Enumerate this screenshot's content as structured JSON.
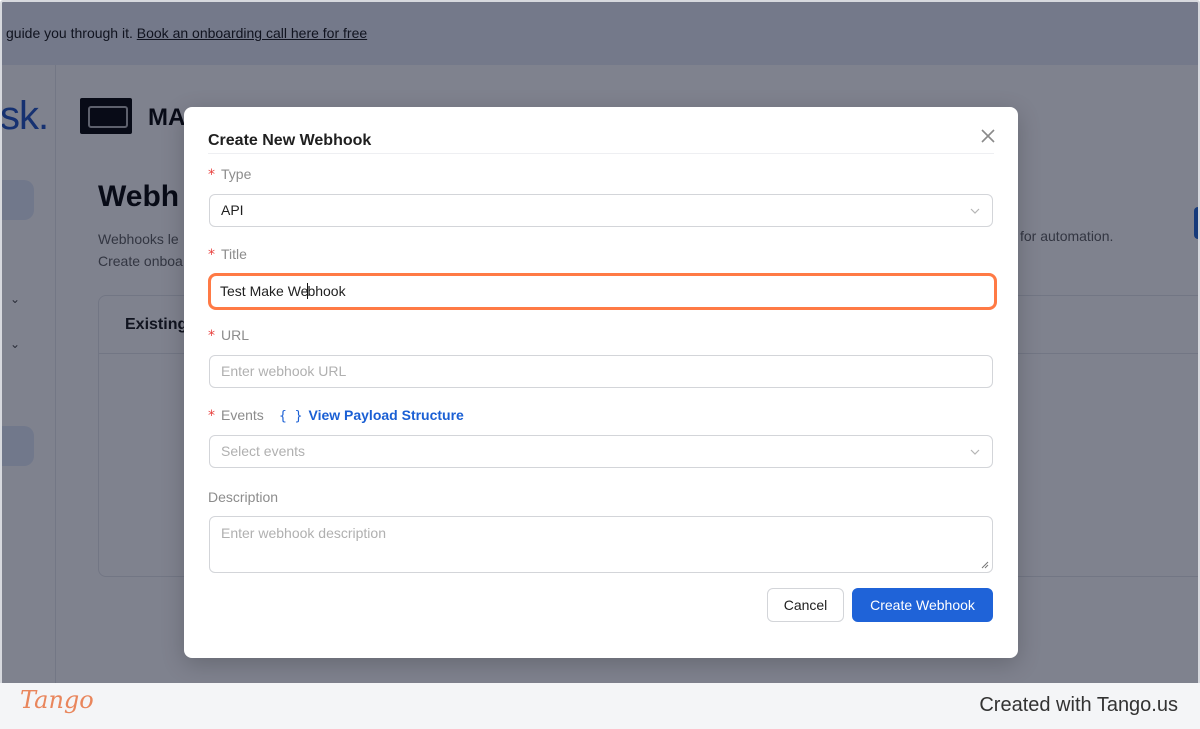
{
  "banner": {
    "text_prefix": "guide you through it. ",
    "link_text": "Book an onboarding call here for free"
  },
  "background": {
    "logo_fragment": "sk.",
    "brand_name": "MA",
    "page_title": "Webh",
    "desc_line1": "Webhooks le",
    "desc_line2": "Create onboa",
    "desc_right": "for automation.",
    "card_title": "Existing"
  },
  "modal": {
    "title": "Create New Webhook",
    "close_icon": "close-icon",
    "type": {
      "label": "Type",
      "required": "*",
      "value": "API"
    },
    "title_field": {
      "label": "Title",
      "required": "*",
      "value_before_caret": "Test Make We",
      "value_after_caret": "bhook"
    },
    "url": {
      "label": "URL",
      "required": "*",
      "placeholder": "Enter webhook URL"
    },
    "events": {
      "label": "Events",
      "required": "*",
      "payload_brace": "{ }",
      "payload_link": "View Payload Structure",
      "placeholder": "Select events"
    },
    "description": {
      "label": "Description",
      "placeholder": "Enter webhook description"
    },
    "cancel_label": "Cancel",
    "create_label": "Create Webhook"
  },
  "footer": {
    "logo": "Tango",
    "credit": "Created with Tango.us"
  },
  "colors": {
    "primary": "#1f63d8",
    "highlight": "#ff7a45",
    "required": "#e8413e",
    "link": "#1a5fd4"
  }
}
